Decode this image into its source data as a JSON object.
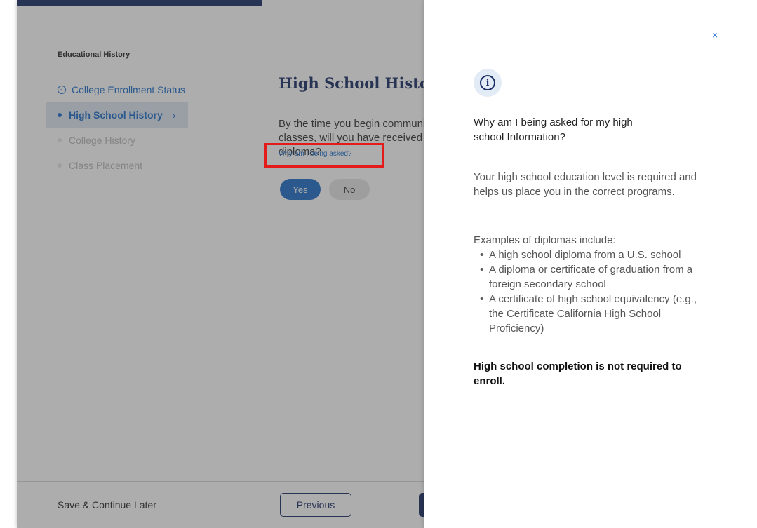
{
  "sidebar": {
    "section_label": "Educational History",
    "items": [
      {
        "label": "College Enrollment Status",
        "state": "complete"
      },
      {
        "label": "High School History",
        "state": "active"
      },
      {
        "label": "College History",
        "state": "upcoming"
      },
      {
        "label": "Class Placement",
        "state": "upcoming"
      }
    ]
  },
  "main": {
    "title": "High School History",
    "question": "By the time you begin community college classes, will you have received a high school diploma?",
    "why_link": "Why am I being asked?",
    "yes_label": "Yes",
    "no_label": "No"
  },
  "footer": {
    "save_later": "Save & Continue Later",
    "previous_label": "Previous"
  },
  "drawer": {
    "close": "×",
    "info_glyph": "i",
    "title": "Why am I being asked for my high school Information?",
    "paragraph": "Your high school education level is required and helps us place you in the correct programs.",
    "examples_heading": "Examples of diplomas include:",
    "examples": [
      "A high school diploma from a U.S. school",
      "A diploma or certificate of graduation from a foreign secondary school",
      "A certificate of high school equivalency (e.g., the Certificate California High School Proficiency)"
    ],
    "note": "High school completion is not required to enroll."
  },
  "colors": {
    "navy": "#1b2f64",
    "link_blue": "#1f6fc9",
    "highlight_red": "#e41b1b"
  }
}
